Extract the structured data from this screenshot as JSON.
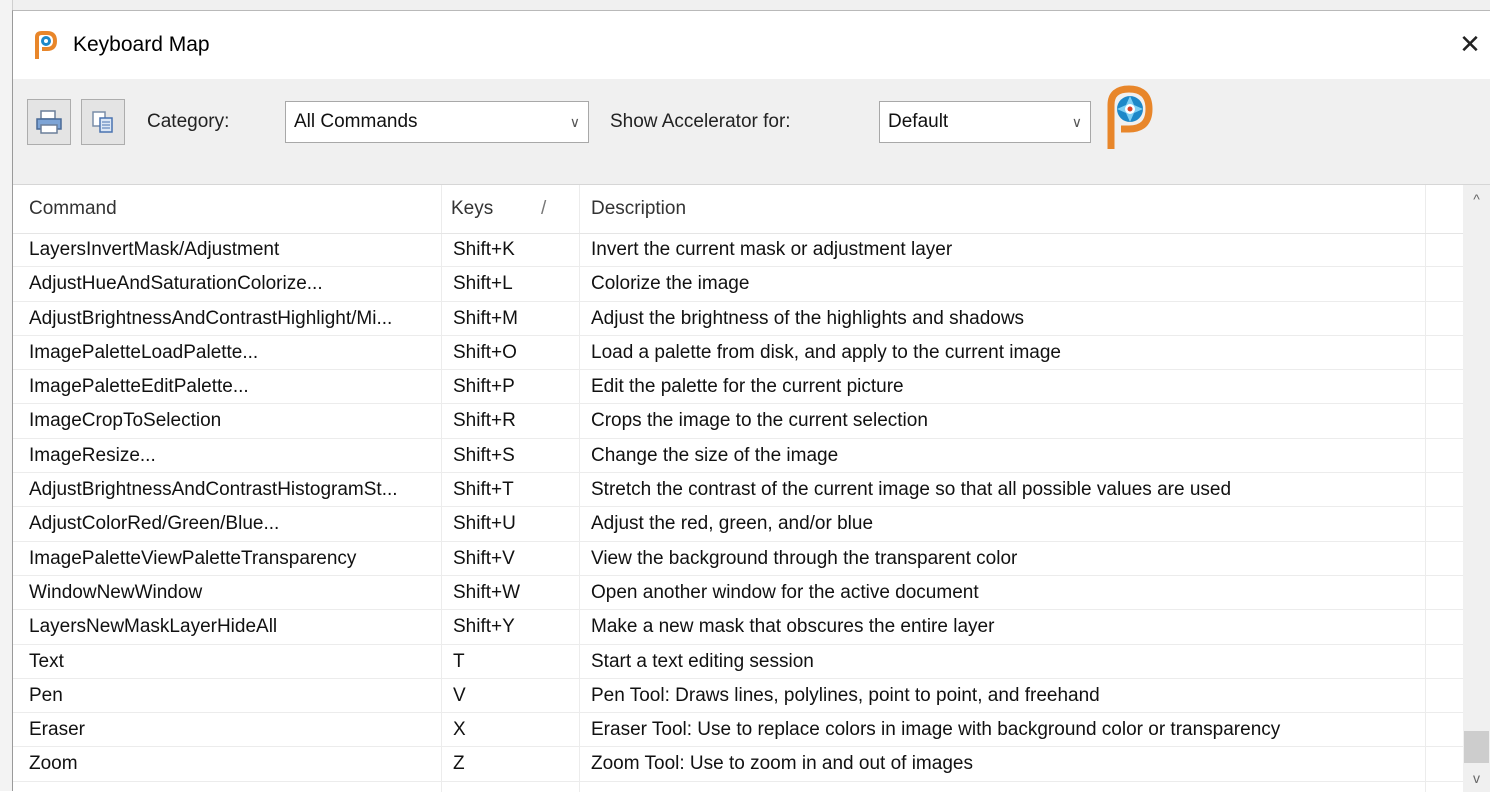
{
  "window": {
    "title": "Keyboard Map",
    "close_glyph": "✕"
  },
  "toolbar": {
    "category_label": "Category:",
    "category_value": "All Commands",
    "accelerator_label": "Show Accelerator for:",
    "accelerator_value": "Default",
    "buttons": [
      {
        "icon": "print-icon"
      },
      {
        "icon": "copy-icon"
      }
    ]
  },
  "table": {
    "headers": {
      "command": "Command",
      "keys": "Keys",
      "sort_glyph": "/",
      "description": "Description"
    },
    "rows": [
      {
        "command": "LayersInvertMask/Adjustment",
        "keys": "Shift+K",
        "description": "Invert the current mask or adjustment layer"
      },
      {
        "command": "AdjustHueAndSaturationColorize...",
        "keys": "Shift+L",
        "description": "Colorize the image"
      },
      {
        "command": "AdjustBrightnessAndContrastHighlight/Mi...",
        "keys": "Shift+M",
        "description": "Adjust the brightness of the highlights and shadows"
      },
      {
        "command": "ImagePaletteLoadPalette...",
        "keys": "Shift+O",
        "description": "Load a palette from disk, and apply to the current image"
      },
      {
        "command": "ImagePaletteEditPalette...",
        "keys": "Shift+P",
        "description": "Edit the palette for the current picture"
      },
      {
        "command": "ImageCropToSelection",
        "keys": "Shift+R",
        "description": "Crops the image to the current selection"
      },
      {
        "command": "ImageResize...",
        "keys": "Shift+S",
        "description": "Change the size of the image"
      },
      {
        "command": "AdjustBrightnessAndContrastHistogramSt...",
        "keys": "Shift+T",
        "description": "Stretch the contrast of the current image so that all possible values are used"
      },
      {
        "command": "AdjustColorRed/Green/Blue...",
        "keys": "Shift+U",
        "description": "Adjust the red, green, and/or blue"
      },
      {
        "command": "ImagePaletteViewPaletteTransparency",
        "keys": "Shift+V",
        "description": "View the background through the transparent color"
      },
      {
        "command": "WindowNewWindow",
        "keys": "Shift+W",
        "description": "Open another window for the active document"
      },
      {
        "command": "LayersNewMaskLayerHideAll",
        "keys": "Shift+Y",
        "description": "Make a new mask that obscures the entire layer"
      },
      {
        "command": "Text",
        "keys": "T",
        "description": "Start a text editing session"
      },
      {
        "command": "Pen",
        "keys": "V",
        "description": "Pen Tool: Draws lines, polylines, point to point, and freehand"
      },
      {
        "command": "Eraser",
        "keys": "X",
        "description": "Eraser Tool: Use to replace colors in image with background color or transparency"
      },
      {
        "command": "Zoom",
        "keys": "Z",
        "description": "Zoom Tool: Use to zoom in and out of images"
      }
    ]
  },
  "scrollbar": {
    "up_glyph": "^",
    "down_glyph": "v"
  }
}
